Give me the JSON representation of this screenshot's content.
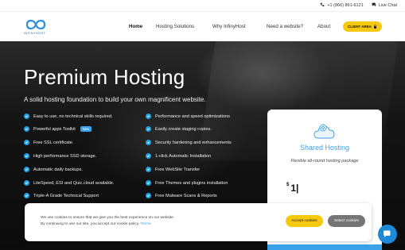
{
  "topbar": {
    "phone": "+1 (866) 861-6121",
    "live_chat": "Live Chat"
  },
  "logo": {
    "text": "INFINYHOST"
  },
  "nav": {
    "items": [
      {
        "label": "Home"
      },
      {
        "label": "Hosting Solutions"
      },
      {
        "label": "Why InfinyHost"
      },
      {
        "label": "Need a website?"
      },
      {
        "label": "About"
      }
    ],
    "client_area": "CLIENT AREA"
  },
  "hero": {
    "title": "Premium Hosting",
    "subtitle": "A solid hosting foundation to build your own magnificent website.",
    "features_left": [
      "Easy to use, no technical skills required.",
      "Powerful apps Toolkit",
      "Free SSL certificate.",
      "High performance SSD storage.",
      "Automatic daily backups.",
      "LiteSpeed, ESI and Quic.cloud available.",
      "Triple-A Grade Technical Support"
    ],
    "new_badge": "New",
    "features_right": [
      "Performance and speed optimizations",
      "Easily create staging copies.",
      "Security hardening and enhancements",
      "1-click Automatic Installation",
      "Free WebSite Transfer",
      "Free Themes and plugins installation",
      "Free Malware Scans & Reports"
    ]
  },
  "plan_card": {
    "title": "Shared Hosting",
    "description": "Flexible all-round hosting package",
    "currency": "$",
    "price": "1|"
  },
  "cookie": {
    "line1": "We use cookies to ensure that we give you the best experience on our website.",
    "line2": "By continuing to use our site, you accept our cookie policy.",
    "terms": "Terms",
    "accept": "Accept cookies",
    "select": "Select cookies"
  },
  "colors": {
    "accent": "#3aa2ea",
    "button_yellow": "#f6c90e",
    "hero_bg": "#141414"
  }
}
